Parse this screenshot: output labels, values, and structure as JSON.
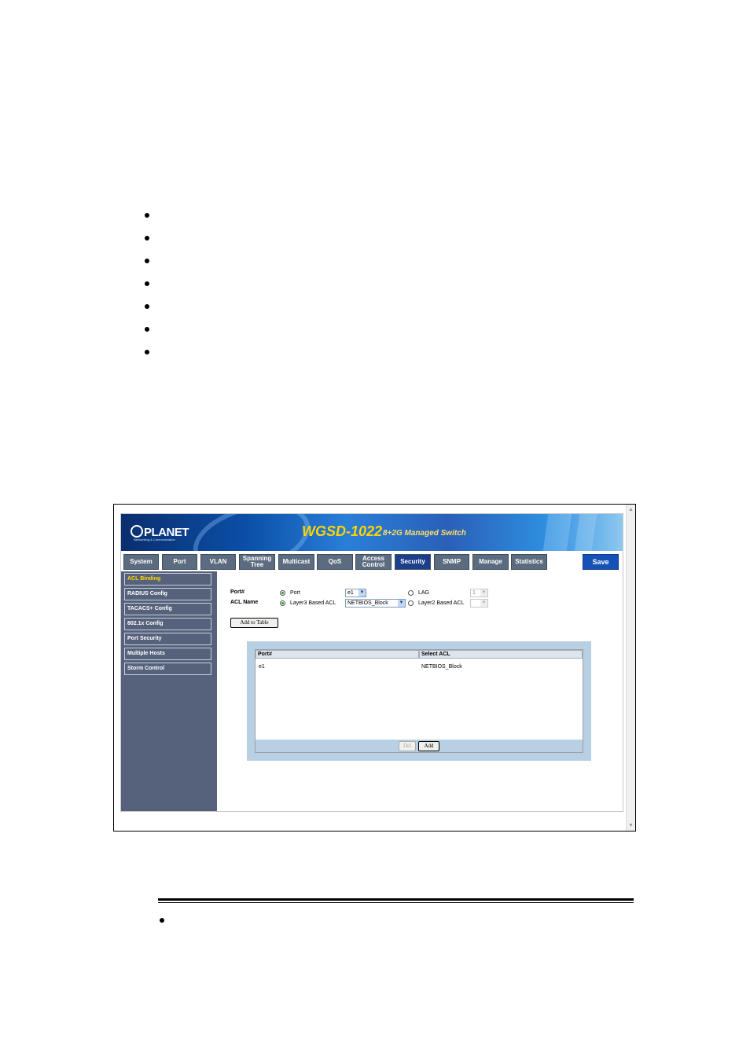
{
  "banner": {
    "logo": "PLANET",
    "logo_tagline": "Networking & Communication",
    "model": "WGSD-1022",
    "description": "8+2G Managed Switch"
  },
  "tabs": [
    {
      "label": "System"
    },
    {
      "label": "Port"
    },
    {
      "label": "VLAN"
    },
    {
      "label": "Spanning Tree"
    },
    {
      "label": "Multicast"
    },
    {
      "label": "QoS"
    },
    {
      "label": "Access Control"
    },
    {
      "label": "Security",
      "active": true
    },
    {
      "label": "SNMP"
    },
    {
      "label": "Manage"
    },
    {
      "label": "Statistics"
    }
  ],
  "save_label": "Save",
  "sidebar": {
    "items": [
      {
        "label": "ACL Binding",
        "active": true
      },
      {
        "label": "RADIUS Config"
      },
      {
        "label": "TACACS+ Config"
      },
      {
        "label": "802.1x Config"
      },
      {
        "label": "Port Security"
      },
      {
        "label": "Multiple Hosts"
      },
      {
        "label": "Storm Control"
      }
    ]
  },
  "form": {
    "port_label": "Port#",
    "acl_name_label": "ACL Name",
    "port_radio": "Port",
    "port_value": "e1",
    "lag_radio": "LAG",
    "lag_value": "1",
    "layer3_radio": "Layer3 Based ACL",
    "layer3_value": "NETBIOS_Block",
    "layer2_radio": "Layer2 Based ACL",
    "layer2_value": "",
    "add_to_table": "Add to Table"
  },
  "table": {
    "headers": [
      "Port#",
      "Select ACL"
    ],
    "rows": [
      {
        "port": "e1",
        "acl": "NETBIOS_Block"
      }
    ],
    "del_label": "Del",
    "add_label": "Add"
  },
  "colors": {
    "tab_bg": "#5c6c80",
    "tab_active": "#1c3f8c",
    "save_bg": "#1552b8",
    "sidebar_bg": "#56627c",
    "sidebar_active_text": "#ffd700",
    "model_text": "#ffd400",
    "table_panel": "#b8d0e4"
  }
}
